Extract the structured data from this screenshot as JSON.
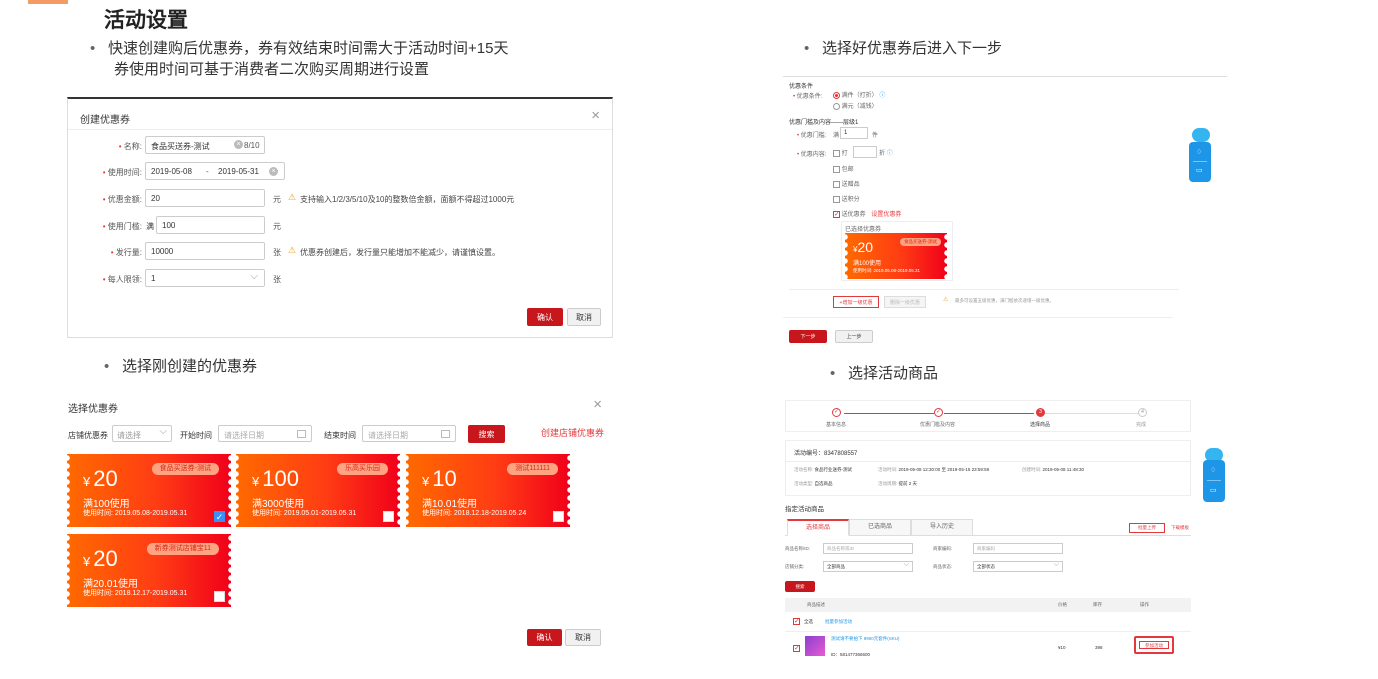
{
  "page": {
    "title": "活动设置"
  },
  "bullets": {
    "b1_line1": "快速创建购后优惠券，券有效结束时间需大于活动时间+15天",
    "b1_line2": "券使用时间可基于消费者二次购买周期进行设置",
    "b2": "选择刚创建的优惠券",
    "b3": "选择好优惠券后进入下一步",
    "b4": "选择活动商品"
  },
  "create_coupon": {
    "title": "创建优惠券",
    "name_label": "名称:",
    "name_value": "食品买送券-测试",
    "name_count": "8/10",
    "time_label": "使用时间:",
    "time_start": "2019-05-08",
    "time_sep": "-",
    "time_end": "2019-05-31",
    "amount_label": "优惠金额:",
    "amount_value": "20",
    "amount_unit": "元",
    "amount_hint": "支持输入1/2/3/5/10及10的整数倍金额，面额不得超过1000元",
    "threshold_label": "使用门槛:",
    "threshold_prefix": "满",
    "threshold_value": "100",
    "threshold_unit": "元",
    "issue_label": "发行量:",
    "issue_value": "10000",
    "issue_unit": "张",
    "issue_hint": "优惠券创建后，发行量只能增加不能减少，请谨慎设置。",
    "limit_label": "每人限领:",
    "limit_value": "1",
    "limit_unit": "张",
    "confirm": "确认",
    "cancel": "取消"
  },
  "select_coupon": {
    "title": "选择优惠券",
    "store_label": "店铺优惠券",
    "store_placeholder": "请选择",
    "start_label": "开始时间",
    "start_placeholder": "请选择日期",
    "end_label": "结束时间",
    "end_placeholder": "请选择日期",
    "search": "搜索",
    "create_link": "创建店铺优惠券",
    "confirm": "确认",
    "cancel": "取消",
    "coupons": [
      {
        "currency": "¥",
        "amount": "20",
        "cond": "满100使用",
        "period": "使用时间: 2019.05.08-2019.05.31",
        "tag": "食品买送券-测试",
        "checked": true
      },
      {
        "currency": "¥",
        "amount": "100",
        "cond": "满3000使用",
        "period": "使用时间: 2019.05.01-2019.05.31",
        "tag": "乐高买乐园",
        "checked": false
      },
      {
        "currency": "¥",
        "amount": "10",
        "cond": "满10.01使用",
        "period": "使用时间: 2018.12.18-2019.05.24",
        "tag": "测试111111",
        "checked": false
      },
      {
        "currency": "¥",
        "amount": "20",
        "cond": "满20.01使用",
        "period": "使用时间: 2018.12.17-2019.05.31",
        "tag": "新券测试店铺宝11",
        "checked": false
      }
    ]
  },
  "benefit": {
    "section1": "优惠条件",
    "cond_label": "优惠条件:",
    "opt1": "满件（打折）",
    "opt2": "满元（减钱）",
    "section2": "优惠门槛及内容——层级1",
    "threshold_label": "优惠门槛:",
    "threshold_prefix": "满",
    "threshold_value": "1",
    "threshold_unit": "件",
    "content_label": "优惠内容:",
    "discount_prefix": "打",
    "discount_unit": "折",
    "c1": "包邮",
    "c2": "送赠品",
    "c3": "送积分",
    "c4": "送优惠券",
    "c4_link": "设置优惠券",
    "chosen_label": "已选择优惠券",
    "mini_currency": "¥",
    "mini_amount": "20",
    "mini_tag": "食品买送券-测试",
    "mini_cond": "满100使用",
    "mini_period": "使用时间: 2019.05.08-2019.05.31",
    "add_level": "+增加一级优惠",
    "del_level": "删除一级优惠",
    "level_hint": "最多可设置五级优惠，满门槛依次递增一级优惠。",
    "next": "下一步",
    "prev": "上一步"
  },
  "goods": {
    "steps": [
      "基本信息",
      "优惠门槛及内容",
      "选择商品",
      "完成"
    ],
    "activity_id": "活动编号：8347808557",
    "name_label": "活动名称:",
    "name_value": "食品行业送券-测试",
    "time_label": "活动时间:",
    "time_value": "2019-05-08 12:30:00 至 2019-05-15 23:59:59",
    "created_label": "创建时间:",
    "created_value": "2019-05-08 11:48:30",
    "type_label": "活动类型:",
    "type_value": "自选商品",
    "cycle_label": "活动周期:",
    "cycle_value": "提前 2 天",
    "section": "指定活动商品",
    "tabs": [
      "选择商品",
      "已选商品",
      "导入历史"
    ],
    "batch_upload": "批量上传",
    "download_tpl": "下载模板",
    "goods_name_label": "商品名称/ID:",
    "goods_name_ph": "商品名称或ID",
    "goods_code_label": "商家编码:",
    "goods_code_ph": "商家编码",
    "cat_label": "店铺分类:",
    "cat_value": "全部商品",
    "status_label": "商品状态:",
    "status_value": "全部状态",
    "search": "搜索",
    "col_desc": "商品描述",
    "col_price": "价格",
    "col_stock": "库存",
    "col_op": "操作",
    "select_all": "全选",
    "batch_join": "批量参加活动",
    "item_title": "测试请不要拍下 9900元套件(SKU)",
    "item_id": "ID：581477366600",
    "item_price": "¥10",
    "item_stock": "398",
    "join": "参加活动"
  },
  "colors": {
    "accent": "#c8161d",
    "coupon_start": "#ff6a00",
    "coupon_end": "#f0001a",
    "link": "#1e96e8"
  }
}
